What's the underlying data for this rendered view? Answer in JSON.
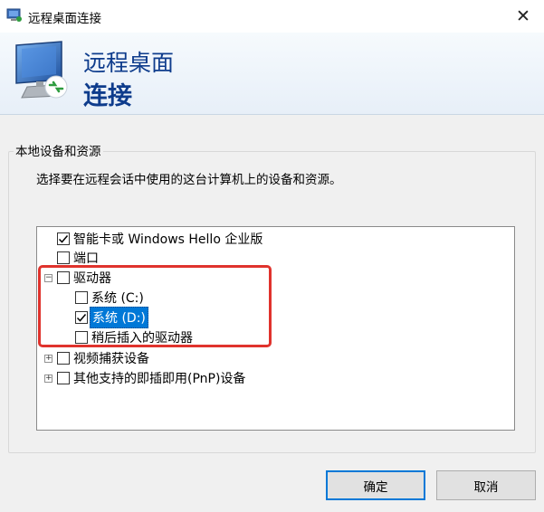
{
  "window": {
    "title": "远程桌面连接",
    "close_symbol": "✕"
  },
  "banner": {
    "line1": "远程桌面",
    "line2": "连接"
  },
  "group": {
    "legend": "本地设备和资源",
    "description": "选择要在远程会话中使用的这台计算机上的设备和资源。"
  },
  "tree": {
    "items": [
      {
        "label": "智能卡或 Windows Hello 企业版",
        "checked": true
      },
      {
        "label": "端口",
        "checked": false
      },
      {
        "label": "驱动器",
        "checked": false,
        "expander": "collapse"
      },
      {
        "label": "系统 (C:)",
        "checked": false
      },
      {
        "label": "系统 (D:)",
        "checked": true,
        "selected": true
      },
      {
        "label": "稍后插入的驱动器",
        "checked": false
      },
      {
        "label": "视频捕获设备",
        "checked": false,
        "expander": "expand"
      },
      {
        "label": "其他支持的即插即用(PnP)设备",
        "checked": false,
        "expander": "expand"
      }
    ]
  },
  "buttons": {
    "ok": "确定",
    "cancel": "取消"
  },
  "colors": {
    "banner_text": "#0e3c8c",
    "selection": "#0078d7",
    "annotation": "#e0332d"
  }
}
